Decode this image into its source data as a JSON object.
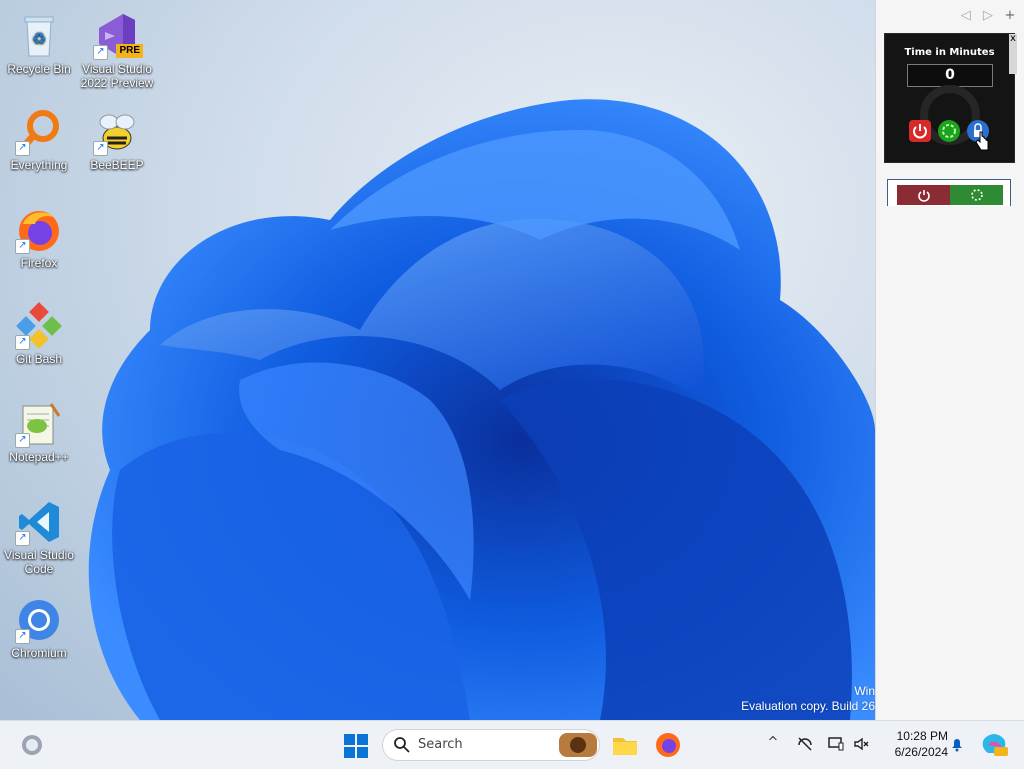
{
  "desktop": {
    "icons": [
      {
        "label": "Recycle Bin",
        "icon": "recycle-bin-icon"
      },
      {
        "label": "Visual Studio 2022 Preview",
        "icon": "visual-studio-preview-icon",
        "badge": "PRE"
      },
      {
        "label": "Everything",
        "icon": "everything-search-icon"
      },
      {
        "label": "BeeBEEP",
        "icon": "beebeep-icon"
      },
      {
        "label": "Firefox",
        "icon": "firefox-icon"
      },
      {
        "label": "Git Bash",
        "icon": "git-bash-icon"
      },
      {
        "label": "Notepad++",
        "icon": "notepad-plus-plus-icon"
      },
      {
        "label": "Visual Studio Code",
        "icon": "vscode-icon"
      },
      {
        "label": "Chromium",
        "icon": "chromium-icon"
      }
    ],
    "watermark_line1": "Win",
    "watermark_line2": "Evaluation copy. Build 26"
  },
  "sidebar": {
    "nav": {
      "prev": "◁",
      "next": "▷",
      "add": "+"
    },
    "timer_gadget": {
      "title": "Time in Minutes",
      "value": "0",
      "close": "x",
      "buttons": [
        "power-icon",
        "restart-icon",
        "lock-icon"
      ]
    }
  },
  "taskbar": {
    "search_placeholder": "Search",
    "time": "10:28 PM",
    "date": "6/26/2024",
    "tray_chevron": "^",
    "colors": {
      "accent": "#0067c0",
      "taskbar_bg": "#eef1f6"
    }
  }
}
